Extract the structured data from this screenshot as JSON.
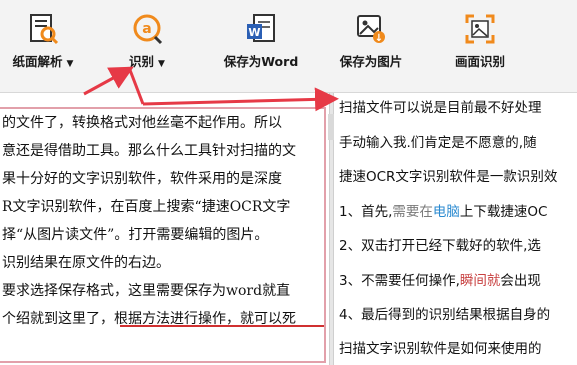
{
  "toolbar": {
    "items": [
      {
        "label": "纸面解析",
        "has_caret": true,
        "caret": "▼",
        "icon": "page-search-icon"
      },
      {
        "label": "识别",
        "has_caret": true,
        "caret": "▼",
        "icon": "recognize-icon"
      },
      {
        "label": "保存为Word",
        "has_caret": false,
        "icon": "word-icon"
      },
      {
        "label": "保存为图片",
        "has_caret": false,
        "icon": "image-save-icon"
      },
      {
        "label": "画面识别",
        "has_caret": false,
        "icon": "screen-capture-icon"
      }
    ]
  },
  "left_panel": {
    "lines": [
      "的文件了，转换格式对他丝毫不起作用。所以",
      "意还是得借助工具。那么什么工具针对扫描的文",
      "果十分好的文字识别软件，软件采用的是深度",
      "R文字识别软件，在百度上搜索“捷速OCR文字",
      "择“从图片读文件”。打开需要编辑的图片。",
      "识别结果在原文件的右边。",
      "要求选择保存格式，这里需要保存为word就直",
      "个绍就到这里了，根据方法进行操作，就可以死"
    ]
  },
  "right_panel": {
    "lines": [
      [
        {
          "t": "扫描文件可以说是目前最不好处理",
          "c": "#111111"
        }
      ],
      [
        {
          "t": "手动输入我.们肯定是不愿意的,随",
          "c": "#111111"
        }
      ],
      [
        {
          "t": "捷速OCR文字识别软件是一款识别效",
          "c": "#111111"
        }
      ],
      [
        {
          "t": "1、首先,",
          "c": "#111111"
        },
        {
          "t": "需要在",
          "c": "#7a7a7a"
        },
        {
          "t": "电脑",
          "c": "#2a8ad0"
        },
        {
          "t": "上下载捷速OC",
          "c": "#111111"
        }
      ],
      [
        {
          "t": "2、双击打开已经下载好的软件,选",
          "c": "#111111"
        }
      ],
      [
        {
          "t": "3、不需要任何操作,",
          "c": "#111111"
        },
        {
          "t": "瞬间就",
          "c": "#c84040"
        },
        {
          "t": "会出现",
          "c": "#111111"
        }
      ],
      [
        {
          "t": "4、最后得到的识别结果根据自身的",
          "c": "#111111"
        }
      ],
      [
        {
          "t": "扫描文字识别软件是如何来使用的",
          "c": "#111111"
        }
      ]
    ]
  },
  "colors": {
    "arrow": "#e63946",
    "frame": "#e2a0aa",
    "link_blue": "#2a8ad0"
  }
}
